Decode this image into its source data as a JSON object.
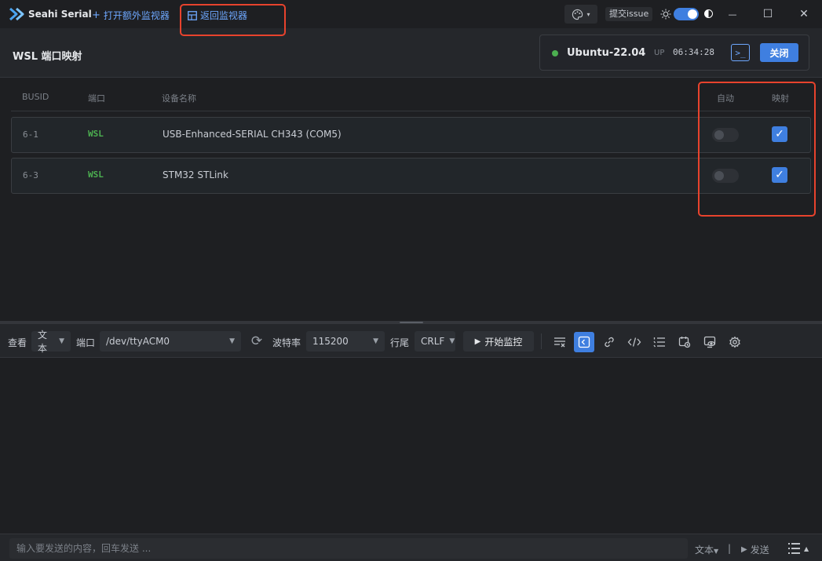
{
  "titlebar": {
    "app_name": "Seahi Serial",
    "open_monitor": "打开额外监视器",
    "back_monitor": "返回监视器",
    "issue": "提交issue",
    "minimize": "—",
    "maximize": "☐",
    "close": "✕"
  },
  "header": {
    "title": "WSL 端口映射",
    "distro": "Ubuntu-22.04",
    "up_label": "UP",
    "uptime": "06:34:28",
    "close_label": "关闭"
  },
  "table": {
    "columns": {
      "busid": "BUSID",
      "port": "端口",
      "device": "设备名称",
      "auto": "自动",
      "map": "映射"
    },
    "rows": [
      {
        "busid": "6-1",
        "port": "WSL",
        "device": "USB-Enhanced-SERIAL CH343 (COM5)",
        "auto": false,
        "mapped": true
      },
      {
        "busid": "6-3",
        "port": "WSL",
        "device": "STM32 STLink",
        "auto": false,
        "mapped": true
      }
    ]
  },
  "toolbar": {
    "view_label": "查看",
    "view_value": "文本",
    "port_label": "端口",
    "port_value": "/dev/ttyACM0",
    "baud_label": "波特率",
    "baud_value": "115200",
    "eol_label": "行尾",
    "eol_value": "CRLF",
    "start_label": "开始监控"
  },
  "sendbar": {
    "placeholder": "输入要发送的内容，回车发送 ...",
    "mode": "文本",
    "separator": "|",
    "send_label": "发送"
  },
  "colors": {
    "accent": "#3f7fe0",
    "status_ok": "#4caf50",
    "highlight": "#e8432d"
  }
}
